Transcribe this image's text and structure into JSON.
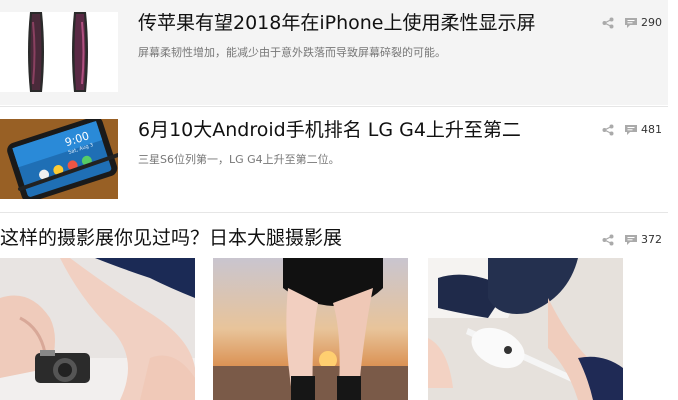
{
  "articles": [
    {
      "title": "传苹果有望2018年在iPhone上使用柔性显示屏",
      "summary": "屏幕柔韧性增加，能减少由于意外跌落而导致屏幕碎裂的可能。",
      "comments": "290"
    },
    {
      "title": "6月10大Android手机排名 LG G4上升至第二",
      "summary": "三星S6位列第一，LG G4上升至第二位。",
      "comments": "481"
    },
    {
      "title": "这样的摄影展你见过吗？日本大腿摄影展",
      "comments": "372"
    }
  ],
  "phone_screen": {
    "time": "9:00",
    "date": "Sat, Aug 3"
  },
  "colors": {
    "title": "#111111",
    "summary": "#777777",
    "highlight_bg": "#f4f4f4",
    "icon": "#aaaaaa"
  },
  "icons": [
    "share-icon",
    "comment-icon"
  ]
}
